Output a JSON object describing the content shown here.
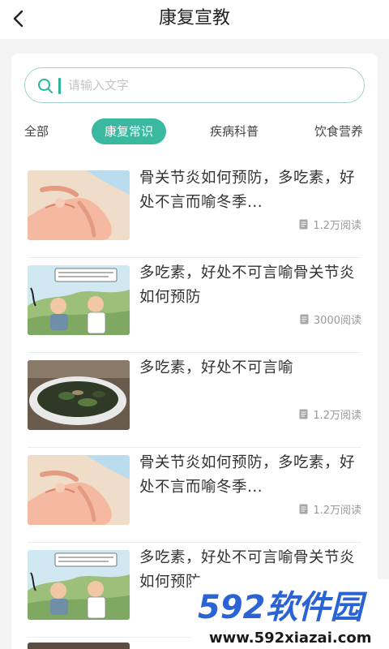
{
  "header": {
    "back_icon": "chevron-left-icon",
    "title": "康复宣教"
  },
  "search": {
    "placeholder": "请输入文字",
    "value": ""
  },
  "tabs": [
    {
      "label": "全部",
      "active": false
    },
    {
      "label": "康复常识",
      "active": true
    },
    {
      "label": "疾病科普",
      "active": false
    },
    {
      "label": "饮食营养",
      "active": false
    }
  ],
  "colors": {
    "accent": "#3ab9a0",
    "search_border": "#9fd2c9"
  },
  "articles": [
    {
      "title": "骨关节炎如何预防，多吃素，好处不言而喻冬季...",
      "reads": "1.2万阅读",
      "thumb": "hand-illustration"
    },
    {
      "title": "多吃素，好处不可言喻骨关节炎如何预防",
      "reads": "3000阅读",
      "thumb": "doctor-cartoon"
    },
    {
      "title": "多吃素，好处不可言喻",
      "reads": "1.2万阅读",
      "thumb": "vegetable-dish"
    },
    {
      "title": "骨关节炎如何预防，多吃素，好处不言而喻冬季...",
      "reads": "1.2万阅读",
      "thumb": "hand-illustration"
    },
    {
      "title": "多吃素，好处不可言喻骨关节炎如何预防",
      "reads": "",
      "thumb": "doctor-cartoon"
    }
  ],
  "watermark": {
    "brand": "592软件园",
    "url": "www.592xiazai.com"
  }
}
